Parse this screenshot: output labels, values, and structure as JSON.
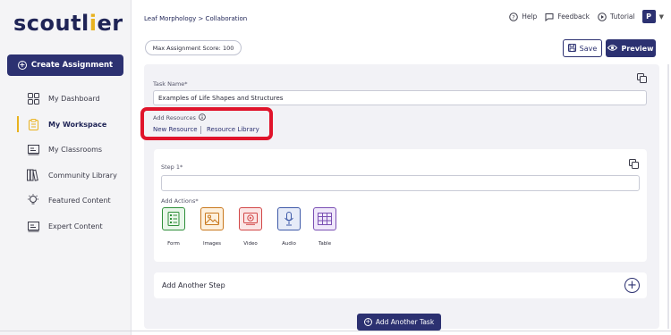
{
  "sidebar": {
    "logo_main": "scoutl",
    "logo_accent": "i",
    "logo_end": "er",
    "create_label": "Create Assignment",
    "items": [
      {
        "label": "My Dashboard",
        "icon": "grid-icon"
      },
      {
        "label": "My Workspace",
        "icon": "clipboard-icon",
        "active": true
      },
      {
        "label": "My Classrooms",
        "icon": "classroom-board-icon"
      },
      {
        "label": "Community Library",
        "icon": "books-icon"
      },
      {
        "label": "Featured Content",
        "icon": "lightbulb-icon"
      },
      {
        "label": "Expert Content",
        "icon": "expert-board-icon"
      }
    ]
  },
  "header": {
    "breadcrumb": "Leaf Morphology > Collaboration",
    "help": "Help",
    "feedback": "Feedback",
    "tutorial": "Tutorial",
    "avatar_initial": "P"
  },
  "toolbar": {
    "max_score": "Max Assignment Score: 100",
    "save": "Save",
    "preview": "Preview"
  },
  "task": {
    "name_label": "Task Name*",
    "name_value": "Examples of Life Shapes and Structures",
    "resources_label": "Add Resources",
    "new_resource": "New Resource",
    "resource_library": "Resource Library"
  },
  "step": {
    "label": "Step 1*",
    "value": "",
    "actions_label": "Add Actions*",
    "actions": [
      {
        "label": "Form",
        "color": "#2f8f3a",
        "bg": "#e9f6ea"
      },
      {
        "label": "Images",
        "color": "#c9781e",
        "bg": "#fdf0dd"
      },
      {
        "label": "Video",
        "color": "#d24747",
        "bg": "#fbe5e5"
      },
      {
        "label": "Audio",
        "color": "#3f5aa8",
        "bg": "#e6ebf8"
      },
      {
        "label": "Table",
        "color": "#7a4fb3",
        "bg": "#efe7fa"
      }
    ]
  },
  "add_another_step": "Add Another Step",
  "add_another_task": "Add Another Task",
  "colors": {
    "brand": "#2c3171",
    "accent": "#e8b21f",
    "highlight": "#e0142b"
  }
}
